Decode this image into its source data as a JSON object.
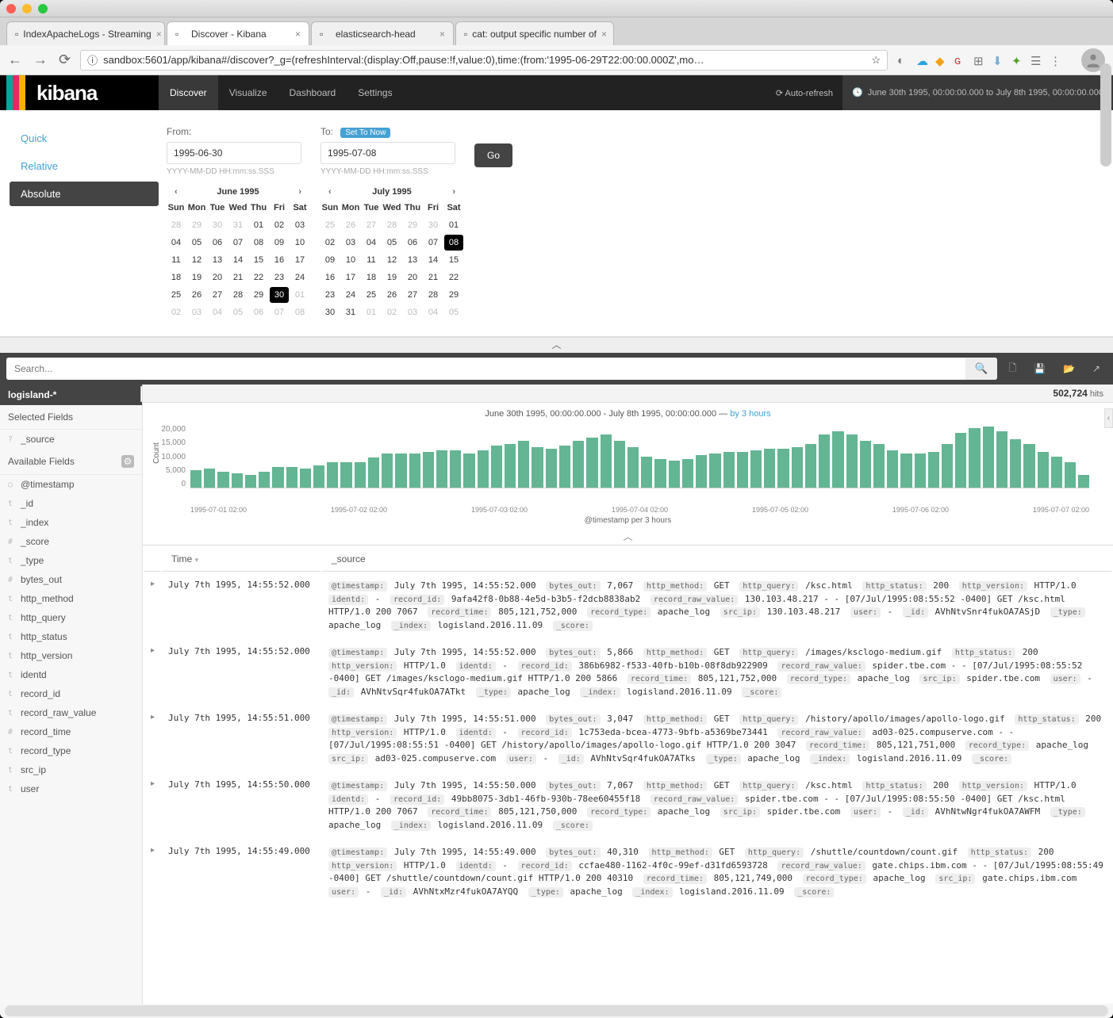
{
  "browser": {
    "tabs": [
      {
        "title": "IndexApacheLogs - Streaming",
        "active": false
      },
      {
        "title": "Discover - Kibana",
        "active": true
      },
      {
        "title": "elasticsearch-head",
        "active": false
      },
      {
        "title": "cat: output specific number of",
        "active": false
      }
    ],
    "url": "sandbox:5601/app/kibana#/discover?_g=(refreshInterval:(display:Off,pause:!f,value:0),time:(from:'1995-06-29T22:00:00.000Z',mo…",
    "star": "☆"
  },
  "chrome": {
    "logo_text": "kibana",
    "nav": [
      {
        "label": "Discover",
        "active": true
      },
      {
        "label": "Visualize",
        "active": false
      },
      {
        "label": "Dashboard",
        "active": false
      },
      {
        "label": "Settings",
        "active": false
      }
    ],
    "auto_refresh": "Auto-refresh",
    "time_range": "June 30th 1995, 00:00:00.000 to July 8th 1995, 00:00:00.000"
  },
  "time_picker": {
    "tabs": [
      "Quick",
      "Relative",
      "Absolute"
    ],
    "active_tab": "Absolute",
    "from_label": "From:",
    "to_label": "To:",
    "set_now": "Set To Now",
    "from_value": "1995-06-30",
    "to_value": "1995-07-08",
    "format_hint": "YYYY-MM-DD HH:mm:ss.SSS",
    "go": "Go",
    "calendars": [
      {
        "title": "June 1995",
        "dow": [
          "Sun",
          "Mon",
          "Tue",
          "Wed",
          "Thu",
          "Fri",
          "Sat"
        ],
        "cells": [
          {
            "d": "28",
            "m": 1
          },
          {
            "d": "29",
            "m": 1
          },
          {
            "d": "30",
            "m": 1
          },
          {
            "d": "31",
            "m": 1
          },
          {
            "d": "01"
          },
          {
            "d": "02"
          },
          {
            "d": "03"
          },
          {
            "d": "04"
          },
          {
            "d": "05"
          },
          {
            "d": "06"
          },
          {
            "d": "07"
          },
          {
            "d": "08"
          },
          {
            "d": "09"
          },
          {
            "d": "10"
          },
          {
            "d": "11"
          },
          {
            "d": "12"
          },
          {
            "d": "13"
          },
          {
            "d": "14"
          },
          {
            "d": "15"
          },
          {
            "d": "16"
          },
          {
            "d": "17"
          },
          {
            "d": "18"
          },
          {
            "d": "19"
          },
          {
            "d": "20"
          },
          {
            "d": "21"
          },
          {
            "d": "22"
          },
          {
            "d": "23"
          },
          {
            "d": "24"
          },
          {
            "d": "25"
          },
          {
            "d": "26"
          },
          {
            "d": "27"
          },
          {
            "d": "28"
          },
          {
            "d": "29"
          },
          {
            "d": "30",
            "sel": 1
          },
          {
            "d": "01",
            "m": 1
          },
          {
            "d": "02",
            "m": 1
          },
          {
            "d": "03",
            "m": 1
          },
          {
            "d": "04",
            "m": 1
          },
          {
            "d": "05",
            "m": 1
          },
          {
            "d": "06",
            "m": 1
          },
          {
            "d": "07",
            "m": 1
          },
          {
            "d": "08",
            "m": 1
          }
        ]
      },
      {
        "title": "July 1995",
        "dow": [
          "Sun",
          "Mon",
          "Tue",
          "Wed",
          "Thu",
          "Fri",
          "Sat"
        ],
        "cells": [
          {
            "d": "25",
            "m": 1
          },
          {
            "d": "26",
            "m": 1
          },
          {
            "d": "27",
            "m": 1
          },
          {
            "d": "28",
            "m": 1
          },
          {
            "d": "29",
            "m": 1
          },
          {
            "d": "30",
            "m": 1
          },
          {
            "d": "01"
          },
          {
            "d": "02"
          },
          {
            "d": "03"
          },
          {
            "d": "04"
          },
          {
            "d": "05"
          },
          {
            "d": "06"
          },
          {
            "d": "07"
          },
          {
            "d": "08",
            "sel": 1
          },
          {
            "d": "09"
          },
          {
            "d": "10"
          },
          {
            "d": "11"
          },
          {
            "d": "12"
          },
          {
            "d": "13"
          },
          {
            "d": "14"
          },
          {
            "d": "15"
          },
          {
            "d": "16"
          },
          {
            "d": "17"
          },
          {
            "d": "18"
          },
          {
            "d": "19"
          },
          {
            "d": "20"
          },
          {
            "d": "21"
          },
          {
            "d": "22"
          },
          {
            "d": "23"
          },
          {
            "d": "24"
          },
          {
            "d": "25"
          },
          {
            "d": "26"
          },
          {
            "d": "27"
          },
          {
            "d": "28"
          },
          {
            "d": "29"
          },
          {
            "d": "30"
          },
          {
            "d": "31"
          },
          {
            "d": "01",
            "m": 1
          },
          {
            "d": "02",
            "m": 1
          },
          {
            "d": "03",
            "m": 1
          },
          {
            "d": "04",
            "m": 1
          },
          {
            "d": "05",
            "m": 1
          }
        ]
      }
    ]
  },
  "search": {
    "placeholder": "Search..."
  },
  "fields": {
    "index_pattern": "logisland-*",
    "selected_heading": "Selected Fields",
    "available_heading": "Available Fields",
    "selected": [
      {
        "t": "?",
        "n": "_source"
      }
    ],
    "available": [
      {
        "t": "○",
        "n": "@timestamp"
      },
      {
        "t": "t",
        "n": "_id"
      },
      {
        "t": "t",
        "n": "_index"
      },
      {
        "t": "#",
        "n": "_score"
      },
      {
        "t": "t",
        "n": "_type"
      },
      {
        "t": "#",
        "n": "bytes_out"
      },
      {
        "t": "t",
        "n": "http_method"
      },
      {
        "t": "t",
        "n": "http_query"
      },
      {
        "t": "t",
        "n": "http_status"
      },
      {
        "t": "t",
        "n": "http_version"
      },
      {
        "t": "t",
        "n": "identd"
      },
      {
        "t": "t",
        "n": "record_id"
      },
      {
        "t": "t",
        "n": "record_raw_value"
      },
      {
        "t": "#",
        "n": "record_time"
      },
      {
        "t": "t",
        "n": "record_type"
      },
      {
        "t": "t",
        "n": "src_ip"
      },
      {
        "t": "t",
        "n": "user"
      }
    ]
  },
  "results": {
    "hits_value": "502,724",
    "hits_label": "hits",
    "histogram_title": "June 30th 1995, 00:00:00.000 - July 8th 1995, 00:00:00.000 — ",
    "histogram_link": "by 3 hours",
    "y_label": "Count",
    "y_ticks": [
      "20,000",
      "15,000",
      "10,000",
      "5,000",
      "0"
    ],
    "x_label": "@timestamp per 3 hours",
    "x_ticks": [
      "1995-07-01 02:00",
      "1995-07-02 02:00",
      "1995-07-03 02:00",
      "1995-07-04 02:00",
      "1995-07-05 02:00",
      "1995-07-06 02:00",
      "1995-07-07 02:00"
    ],
    "table_headers": {
      "time": "Time",
      "source": "_source"
    },
    "docs": [
      {
        "time": "July 7th 1995, 14:55:52.000",
        "fields": [
          [
            "@timestamp:",
            "July 7th 1995, 14:55:52.000"
          ],
          [
            "bytes_out:",
            "7,067"
          ],
          [
            "http_method:",
            "GET"
          ],
          [
            "http_query:",
            "/ksc.html"
          ],
          [
            "http_status:",
            "200"
          ],
          [
            "http_version:",
            "HTTP/1.0"
          ],
          [
            "identd:",
            "-"
          ],
          [
            "record_id:",
            "9afa42f8-0b88-4e5d-b3b5-f2dcb8838ab2"
          ],
          [
            "record_raw_value:",
            "130.103.48.217 - - [07/Jul/1995:08:55:52 -0400] GET /ksc.html HTTP/1.0 200 7067"
          ],
          [
            "record_time:",
            "805,121,752,000"
          ],
          [
            "record_type:",
            "apache_log"
          ],
          [
            "src_ip:",
            "130.103.48.217"
          ],
          [
            "user:",
            "-"
          ],
          [
            "_id:",
            "AVhNtvSnr4fukOA7ASjD"
          ],
          [
            "_type:",
            "apache_log"
          ],
          [
            "_index:",
            "logisland.2016.11.09"
          ],
          [
            "_score:",
            ""
          ]
        ]
      },
      {
        "time": "July 7th 1995, 14:55:52.000",
        "fields": [
          [
            "@timestamp:",
            "July 7th 1995, 14:55:52.000"
          ],
          [
            "bytes_out:",
            "5,866"
          ],
          [
            "http_method:",
            "GET"
          ],
          [
            "http_query:",
            "/images/ksclogo-medium.gif"
          ],
          [
            "http_status:",
            "200"
          ],
          [
            "http_version:",
            "HTTP/1.0"
          ],
          [
            "identd:",
            "-"
          ],
          [
            "record_id:",
            "386b6982-f533-40fb-b10b-08f8db922909"
          ],
          [
            "record_raw_value:",
            "spider.tbe.com - - [07/Jul/1995:08:55:52 -0400] GET /images/ksclogo-medium.gif HTTP/1.0 200 5866"
          ],
          [
            "record_time:",
            "805,121,752,000"
          ],
          [
            "record_type:",
            "apache_log"
          ],
          [
            "src_ip:",
            "spider.tbe.com"
          ],
          [
            "user:",
            "-"
          ],
          [
            "_id:",
            "AVhNtvSqr4fukOA7ATkt"
          ],
          [
            "_type:",
            "apache_log"
          ],
          [
            "_index:",
            "logisland.2016.11.09"
          ],
          [
            "_score:",
            ""
          ]
        ]
      },
      {
        "time": "July 7th 1995, 14:55:51.000",
        "fields": [
          [
            "@timestamp:",
            "July 7th 1995, 14:55:51.000"
          ],
          [
            "bytes_out:",
            "3,047"
          ],
          [
            "http_method:",
            "GET"
          ],
          [
            "http_query:",
            "/history/apollo/images/apollo-logo.gif"
          ],
          [
            "http_status:",
            "200"
          ],
          [
            "http_version:",
            "HTTP/1.0"
          ],
          [
            "identd:",
            "-"
          ],
          [
            "record_id:",
            "1c753eda-bcea-4773-9bfb-a5369be73441"
          ],
          [
            "record_raw_value:",
            "ad03-025.compuserve.com - - [07/Jul/1995:08:55:51 -0400] GET /history/apollo/images/apollo-logo.gif HTTP/1.0 200 3047"
          ],
          [
            "record_time:",
            "805,121,751,000"
          ],
          [
            "record_type:",
            "apache_log"
          ],
          [
            "src_ip:",
            "ad03-025.compuserve.com"
          ],
          [
            "user:",
            "-"
          ],
          [
            "_id:",
            "AVhNtvSqr4fukOA7ATks"
          ],
          [
            "_type:",
            "apache_log"
          ],
          [
            "_index:",
            "logisland.2016.11.09"
          ],
          [
            "_score:",
            ""
          ]
        ]
      },
      {
        "time": "July 7th 1995, 14:55:50.000",
        "fields": [
          [
            "@timestamp:",
            "July 7th 1995, 14:55:50.000"
          ],
          [
            "bytes_out:",
            "7,067"
          ],
          [
            "http_method:",
            "GET"
          ],
          [
            "http_query:",
            "/ksc.html"
          ],
          [
            "http_status:",
            "200"
          ],
          [
            "http_version:",
            "HTTP/1.0"
          ],
          [
            "identd:",
            "-"
          ],
          [
            "record_id:",
            "49bb8075-3db1-46fb-930b-78ee60455f18"
          ],
          [
            "record_raw_value:",
            "spider.tbe.com - - [07/Jul/1995:08:55:50 -0400] GET /ksc.html HTTP/1.0 200 7067"
          ],
          [
            "record_time:",
            "805,121,750,000"
          ],
          [
            "record_type:",
            "apache_log"
          ],
          [
            "src_ip:",
            "spider.tbe.com"
          ],
          [
            "user:",
            "-"
          ],
          [
            "_id:",
            "AVhNtwNgr4fukOA7AWFM"
          ],
          [
            "_type:",
            "apache_log"
          ],
          [
            "_index:",
            "logisland.2016.11.09"
          ],
          [
            "_score:",
            ""
          ]
        ]
      },
      {
        "time": "July 7th 1995, 14:55:49.000",
        "fields": [
          [
            "@timestamp:",
            "July 7th 1995, 14:55:49.000"
          ],
          [
            "bytes_out:",
            "40,310"
          ],
          [
            "http_method:",
            "GET"
          ],
          [
            "http_query:",
            "/shuttle/countdown/count.gif"
          ],
          [
            "http_status:",
            "200"
          ],
          [
            "http_version:",
            "HTTP/1.0"
          ],
          [
            "identd:",
            "-"
          ],
          [
            "record_id:",
            "ccfae480-1162-4f0c-99ef-d31fd6593728"
          ],
          [
            "record_raw_value:",
            "gate.chips.ibm.com - - [07/Jul/1995:08:55:49 -0400] GET /shuttle/countdown/count.gif HTTP/1.0 200 40310"
          ],
          [
            "record_time:",
            "805,121,749,000"
          ],
          [
            "record_type:",
            "apache_log"
          ],
          [
            "src_ip:",
            "gate.chips.ibm.com"
          ],
          [
            "user:",
            "-"
          ],
          [
            "_id:",
            "AVhNtxMzr4fukOA7AYQQ"
          ],
          [
            "_type:",
            "apache_log"
          ],
          [
            "_index:",
            "logisland.2016.11.09"
          ],
          [
            "_score:",
            ""
          ]
        ]
      }
    ]
  },
  "chart_data": {
    "type": "bar",
    "title": "@timestamp per 3 hours",
    "ylabel": "Count",
    "ylim": [
      0,
      20000
    ],
    "x_ticks": [
      "1995-07-01 02:00",
      "1995-07-02 02:00",
      "1995-07-03 02:00",
      "1995-07-04 02:00",
      "1995-07-05 02:00",
      "1995-07-06 02:00",
      "1995-07-07 02:00"
    ],
    "values": [
      5500,
      6000,
      5000,
      4500,
      4000,
      5000,
      6500,
      6500,
      6000,
      7000,
      8000,
      8000,
      8000,
      9500,
      11000,
      11000,
      11000,
      11500,
      12000,
      12000,
      11000,
      12000,
      13500,
      14000,
      15000,
      13000,
      12500,
      13500,
      15000,
      16000,
      17000,
      15000,
      13000,
      10000,
      9000,
      8500,
      9000,
      10500,
      11000,
      11500,
      11500,
      12000,
      12500,
      12500,
      13000,
      14000,
      17000,
      18000,
      17000,
      15000,
      14000,
      12000,
      11000,
      11000,
      11500,
      14000,
      17500,
      19000,
      19500,
      18000,
      15500,
      14000,
      11500,
      10000,
      8000,
      4000
    ]
  }
}
